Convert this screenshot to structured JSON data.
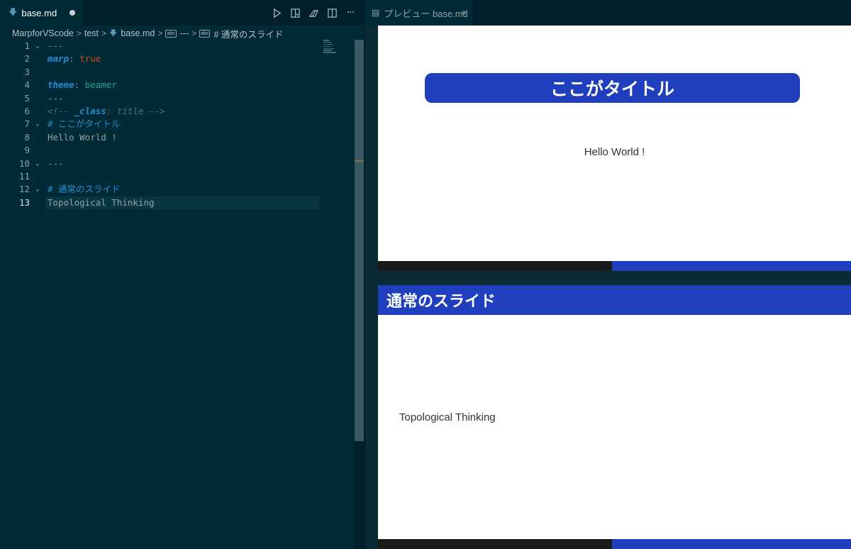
{
  "editor": {
    "tab": {
      "filename": "base.md",
      "file_icon": "markdown-icon",
      "modified": true
    },
    "actions": [
      {
        "name": "run-icon"
      },
      {
        "name": "open-preview-icon"
      },
      {
        "name": "marp-commands-icon"
      },
      {
        "name": "split-editor-icon"
      },
      {
        "name": "more-actions-icon",
        "label": "···"
      }
    ],
    "breadcrumb": {
      "folder1": "MarpforVScode",
      "folder2": "test",
      "file": "base.md",
      "section1": "---",
      "section2": "# 通常のスライド",
      "separator": ">"
    },
    "lines": [
      {
        "n": "1",
        "fold": "⌄"
      },
      {
        "n": "2"
      },
      {
        "n": "3"
      },
      {
        "n": "4"
      },
      {
        "n": "5"
      },
      {
        "n": "6"
      },
      {
        "n": "7",
        "fold": "⌄"
      },
      {
        "n": "8"
      },
      {
        "n": "9"
      },
      {
        "n": "10",
        "fold": "⌄"
      },
      {
        "n": "11"
      },
      {
        "n": "12",
        "fold": "⌄"
      },
      {
        "n": "13"
      }
    ],
    "code": {
      "l1": "---",
      "l2_key": "marp",
      "l2_colon": ":",
      "l2_val": " true",
      "l4_key": "theme",
      "l4_colon": ":",
      "l4_val": " beamer",
      "l5": "---",
      "l6_open": "<!-- ",
      "l6_key": "_class",
      "l6_rest": ": title -->",
      "l7": "# ここがタイトル",
      "l8": "Hello World !",
      "l10": "---",
      "l12": "# 通常のスライド",
      "l13": "Topological Thinking"
    }
  },
  "preview": {
    "tab": {
      "label": "プレビュー base.md",
      "icon": "preview-icon",
      "close": "×"
    },
    "slide1": {
      "title": "ここがタイトル",
      "body": "Hello World !"
    },
    "slide2": {
      "heading": "通常のスライド",
      "body": "Topological Thinking"
    }
  },
  "colors": {
    "editor_bg": "#002b36",
    "accent_blue": "#1f3fbf",
    "footer_dark": "#1a1a1a"
  }
}
